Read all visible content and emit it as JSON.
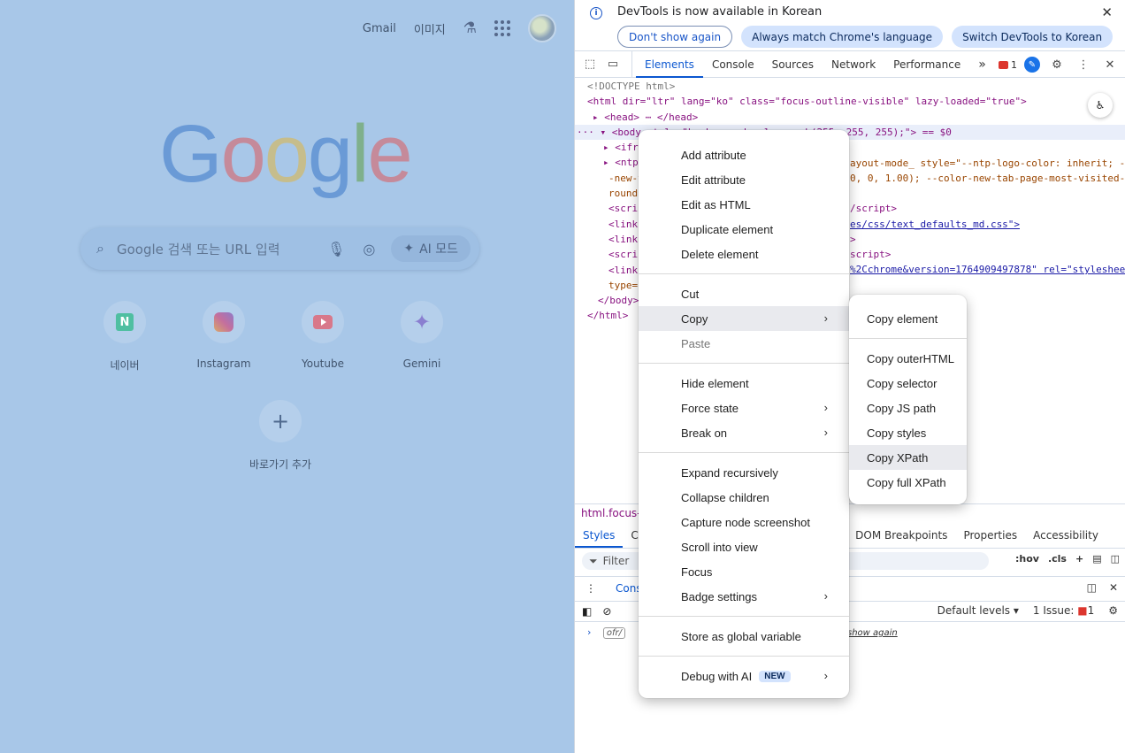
{
  "ntp": {
    "top_links": [
      "Gmail",
      "이미지"
    ],
    "logo": [
      "G",
      "o",
      "o",
      "g",
      "l",
      "e"
    ],
    "search_placeholder": "Google 검색 또는 URL 입력",
    "ai_mode_label": "AI 모드",
    "shortcuts": [
      {
        "label": "네이버",
        "icon": "naver-icon"
      },
      {
        "label": "Instagram",
        "icon": "instagram-icon"
      },
      {
        "label": "Youtube",
        "icon": "youtube-icon"
      },
      {
        "label": "Gemini",
        "icon": "gemini-icon"
      }
    ],
    "add_shortcut_label": "바로가기 추가"
  },
  "devtools": {
    "infobar": {
      "message": "DevTools is now available in Korean",
      "buttons": [
        "Don't show again",
        "Always match Chrome's language",
        "Switch DevTools to Korean"
      ]
    },
    "tabs": [
      "Elements",
      "Console",
      "Sources",
      "Network",
      "Performance"
    ],
    "error_count": "1",
    "dom_lines": [
      "<!DOCTYPE html>",
      "<html dir=\"ltr\" lang=\"ko\" class=\"focus-outline-visible\" lazy-loaded=\"true\">",
      "▸ <head> ⋯ </head>",
      "··· ▾ <body style=\"background-color: rgb(255, 255, 255);\"> == $0",
      "▸ <iframe",
      "▸ <ntp-a",
      "-new-t",
      "round:",
      "<scrip",
      "<link",
      "<link",
      "<scrip",
      "<link",
      "type=\"",
      "</body>",
      "</html>"
    ],
    "dom_right_fragments": [
      "ayout-mode_ style=\"--ntp-logo-color: inherit; --colo",
      " 0, 0, 1.00); --color-new-tab-page-most-visited-fores",
      "/script>",
      "es/css/text_defaults_md.css\">",
      ">",
      "script>",
      "%2Cchrome&version=1764909497878\" rel=\"stylesheet\""
    ],
    "breadcrumb": "html.focus-o",
    "sub_tabs_left": [
      "Styles",
      "Co"
    ],
    "sub_tabs_right": [
      "DOM Breakpoints",
      "Properties",
      "Accessibility"
    ],
    "filter_placeholder": "Filter",
    "filter_tools": [
      ":hov",
      ".cls"
    ],
    "drawer_tab": "Conso",
    "default_levels": "Default levels",
    "issues": "1 Issue:",
    "issues_count": "1",
    "console_tag": "ofr/",
    "console_link": "show again"
  },
  "context_menu": {
    "groups": [
      [
        "Add attribute",
        "Edit attribute",
        "Edit as HTML",
        "Duplicate element",
        "Delete element"
      ],
      [
        "Cut",
        "Copy",
        "Paste"
      ],
      [
        "Hide element",
        "Force state",
        "Break on"
      ],
      [
        "Expand recursively",
        "Collapse children",
        "Capture node screenshot",
        "Scroll into view",
        "Focus",
        "Badge settings"
      ],
      [
        "Store as global variable"
      ],
      [
        "Debug with AI"
      ]
    ],
    "new_badge": "NEW"
  },
  "copy_submenu": {
    "groups": [
      [
        "Copy element"
      ],
      [
        "Copy outerHTML",
        "Copy selector",
        "Copy JS path",
        "Copy styles",
        "Copy XPath",
        "Copy full XPath"
      ]
    ]
  }
}
